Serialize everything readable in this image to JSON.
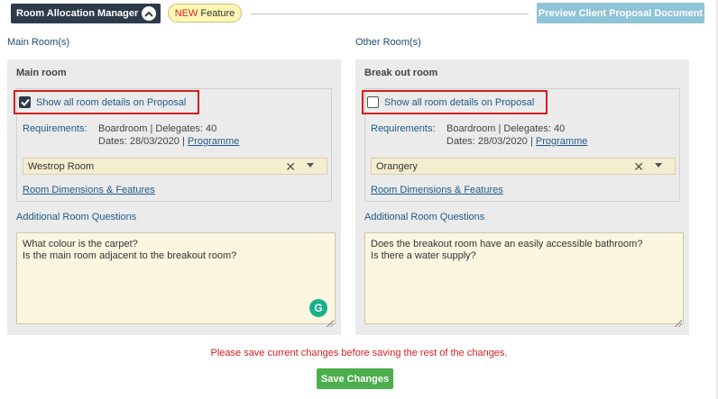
{
  "header": {
    "manager_label": "Room Allocation Manager",
    "badge_new": "NEW",
    "badge_feature": "Feature",
    "preview_label": "Preview Client Proposal Document"
  },
  "left": {
    "section_title": "Main Room(s)",
    "panel_title": "Main room",
    "show_details_label": "Show all room details on Proposal",
    "show_details_checked": true,
    "requirements_label": "Requirements:",
    "requirements_line1": "Boardroom | Delegates: 40",
    "dates_text": "Dates: 28/03/2020 |",
    "programme_link": "Programme",
    "room_value": "Westrop Room",
    "dimensions_link": "Room Dimensions & Features",
    "questions_label": "Additional Room Questions",
    "questions_text": "What colour is the carpet?\nIs the main room adjacent to the breakout room?"
  },
  "right": {
    "section_title": "Other Room(s)",
    "panel_title": "Break out room",
    "show_details_label": "Show all room details on Proposal",
    "show_details_checked": false,
    "requirements_label": "Requirements:",
    "requirements_line1": "Boardroom | Delegates: 40",
    "dates_text": "Dates: 28/03/2020 |",
    "programme_link": "Programme",
    "room_value": "Orangery",
    "dimensions_link": "Room Dimensions & Features",
    "questions_label": "Additional Room Questions",
    "questions_text": "Does the breakout room have an easily accessible bathroom?\nIs there a water supply?"
  },
  "footer": {
    "warning": "Please save current changes before saving the rest of the changes.",
    "save_label": "Save Changes"
  },
  "colors": {
    "accent_dark": "#2d3a4a",
    "link_blue": "#1e5a8a",
    "warning_red": "#d21f1f",
    "save_green": "#4cae4c",
    "preview_disabled": "#8fc3d6"
  },
  "icons": {
    "manager_toggle": "chevron-up-icon",
    "clear": "close-icon",
    "dropdown": "caret-down-icon",
    "grammarly": "grammarly-icon"
  }
}
